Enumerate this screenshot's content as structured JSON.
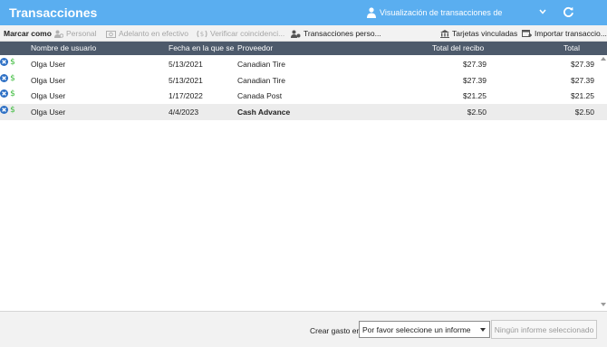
{
  "header": {
    "title": "Transacciones",
    "view_label": "Visualización de transacciones de"
  },
  "toolbar": {
    "mark_as": "Marcar como",
    "personal": "Personal",
    "cash_advance": "Adelanto en efectivo",
    "verify_matches": "Verificar coincidenci...",
    "custom_transactions": "Transacciones perso...",
    "linked_cards": "Tarjetas vinculadas",
    "import_transactions": "Importar transaccio..."
  },
  "table": {
    "columns": [
      "Nombre de usuario",
      "Fecha en la que se i",
      "Proveedor",
      "Total del recibo",
      "Total"
    ],
    "rows": [
      {
        "user": "Olga User",
        "date": "5/13/2021",
        "vendor": "Canadian Tire",
        "receipt_total": "$27.39",
        "total": "$27.39"
      },
      {
        "user": "Olga User",
        "date": "5/13/2021",
        "vendor": "Canadian Tire",
        "receipt_total": "$27.39",
        "total": "$27.39"
      },
      {
        "user": "Olga User",
        "date": "1/17/2022",
        "vendor": "Canada Post",
        "receipt_total": "$21.25",
        "total": "$21.25"
      },
      {
        "user": "Olga User",
        "date": "4/4/2023",
        "vendor": "Cash Advance",
        "receipt_total": "$2.50",
        "total": "$2.50"
      }
    ]
  },
  "footer": {
    "create_expense_label": "Crear gasto en:",
    "report_select_value": "Por favor seleccione un informe",
    "no_report_button": "Ningún informe seleccionado"
  },
  "colors": {
    "header_bg": "#5aaef0",
    "table_header_bg": "#4d5a6b",
    "delete_icon": "#2c6fc4",
    "receipt_icon": "#3dbb3d"
  }
}
